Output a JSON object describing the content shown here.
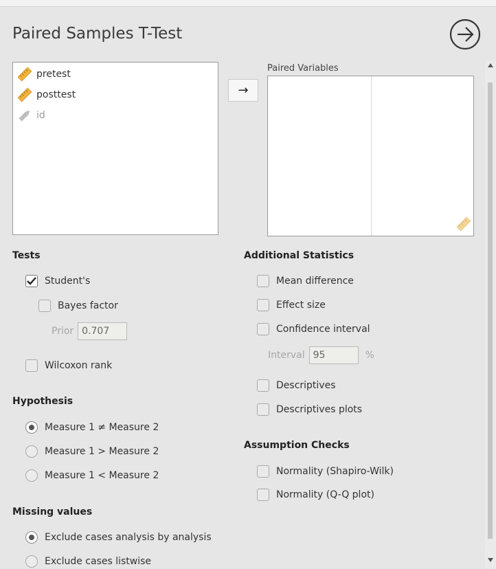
{
  "header": {
    "title": "Paired Samples T-Test"
  },
  "variables": [
    {
      "name": "pretest",
      "icon": "ruler-icon",
      "enabled": true
    },
    {
      "name": "posttest",
      "icon": "ruler-icon",
      "enabled": true
    },
    {
      "name": "id",
      "icon": "nominal-pencil-icon",
      "enabled": false
    }
  ],
  "move_button": {
    "label": "→"
  },
  "paired": {
    "label": "Paired Variables"
  },
  "tests": {
    "heading": "Tests",
    "student": {
      "label": "Student's",
      "checked": true
    },
    "bayes": {
      "label": "Bayes factor",
      "checked": false
    },
    "prior": {
      "label": "Prior",
      "value": "0.707"
    },
    "wilcoxon": {
      "label": "Wilcoxon rank",
      "checked": false
    }
  },
  "hypothesis": {
    "heading": "Hypothesis",
    "options": [
      {
        "label": "Measure 1 ≠ Measure 2",
        "selected": true
      },
      {
        "label": "Measure 1 > Measure 2",
        "selected": false
      },
      {
        "label": "Measure 1 < Measure 2",
        "selected": false
      }
    ]
  },
  "missing": {
    "heading": "Missing values",
    "options": [
      {
        "label": "Exclude cases analysis by analysis",
        "selected": true
      },
      {
        "label": "Exclude cases listwise",
        "selected": false
      }
    ]
  },
  "additional": {
    "heading": "Additional Statistics",
    "mean_diff": {
      "label": "Mean difference",
      "checked": false
    },
    "effect_size": {
      "label": "Effect size",
      "checked": false
    },
    "ci": {
      "label": "Confidence interval",
      "checked": false
    },
    "interval": {
      "label": "Interval",
      "value": "95",
      "unit": "%"
    },
    "descriptives": {
      "label": "Descriptives",
      "checked": false
    },
    "desc_plots": {
      "label": "Descriptives plots",
      "checked": false
    }
  },
  "assumptions": {
    "heading": "Assumption Checks",
    "shapiro": {
      "label": "Normality (Shapiro-Wilk)",
      "checked": false
    },
    "qq": {
      "label": "Normality (Q-Q plot)",
      "checked": false
    }
  },
  "colors": {
    "ruler": "#f0b43c",
    "panel": "#e6e6e6"
  }
}
